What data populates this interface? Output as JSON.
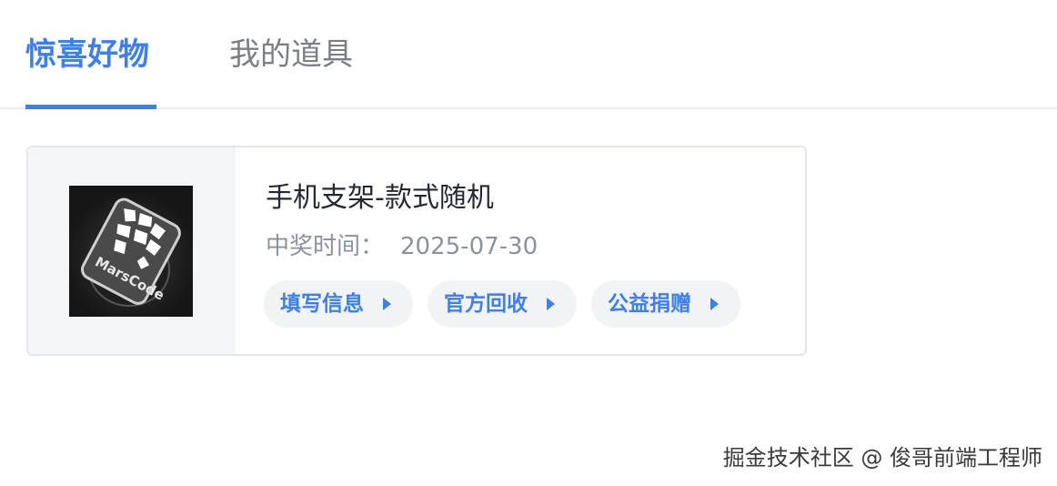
{
  "tabs": [
    {
      "label": "惊喜好物",
      "active": true
    },
    {
      "label": "我的道具",
      "active": false
    }
  ],
  "prize": {
    "image_alt": "MarsCode",
    "title": "手机支架-款式随机",
    "time_label": "中奖时间：",
    "time_value": "2025-07-30",
    "actions": [
      {
        "label": "填写信息"
      },
      {
        "label": "官方回收"
      },
      {
        "label": "公益捐赠"
      }
    ]
  },
  "watermark": "掘金技术社区 @ 俊哥前端工程师",
  "colors": {
    "accent": "#3b7ef6",
    "text_primary": "#252933",
    "text_secondary": "#8a919f",
    "button_bg": "#f2f3f5"
  }
}
